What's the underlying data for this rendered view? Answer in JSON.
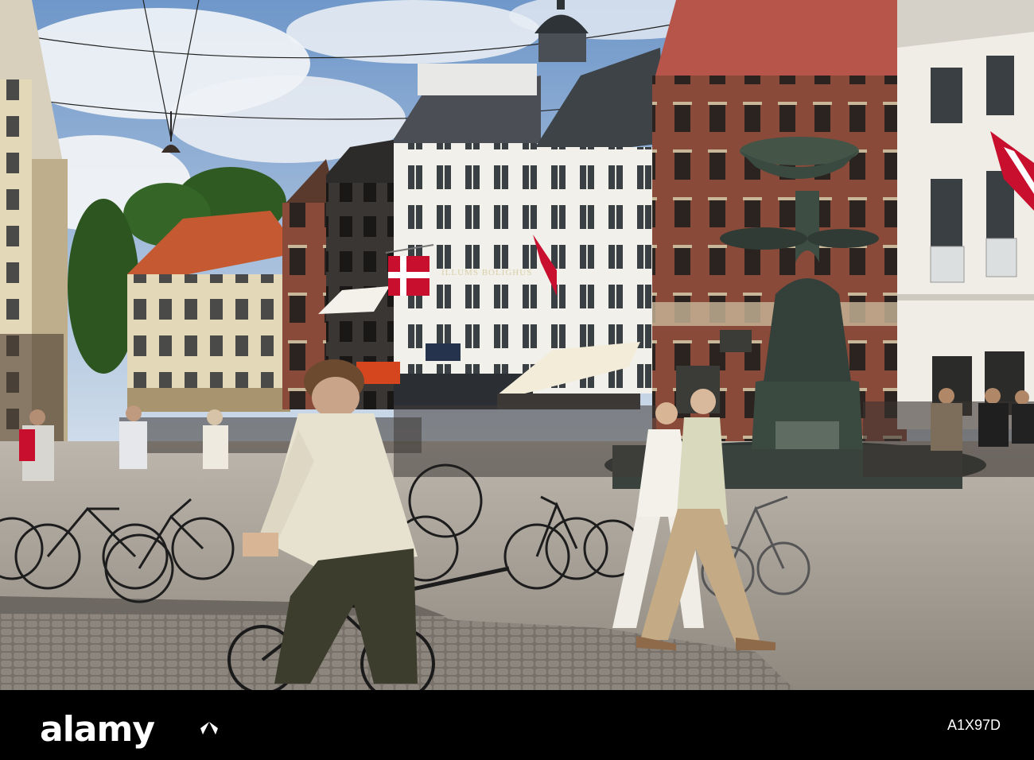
{
  "photo": {
    "subject": "Pedestrian square with fountain, cyclists and historic facades",
    "storefront_sign": "ILLUMS BOLIGHUS"
  },
  "footer": {
    "brand": "alamy",
    "image_id": "A1X97D"
  },
  "colors": {
    "sky": "#9dbbd9",
    "brick": "#8a4a3a",
    "fountain": "#3b4a40",
    "pavement": "#a9a39a",
    "flag_red": "#c8102e"
  }
}
